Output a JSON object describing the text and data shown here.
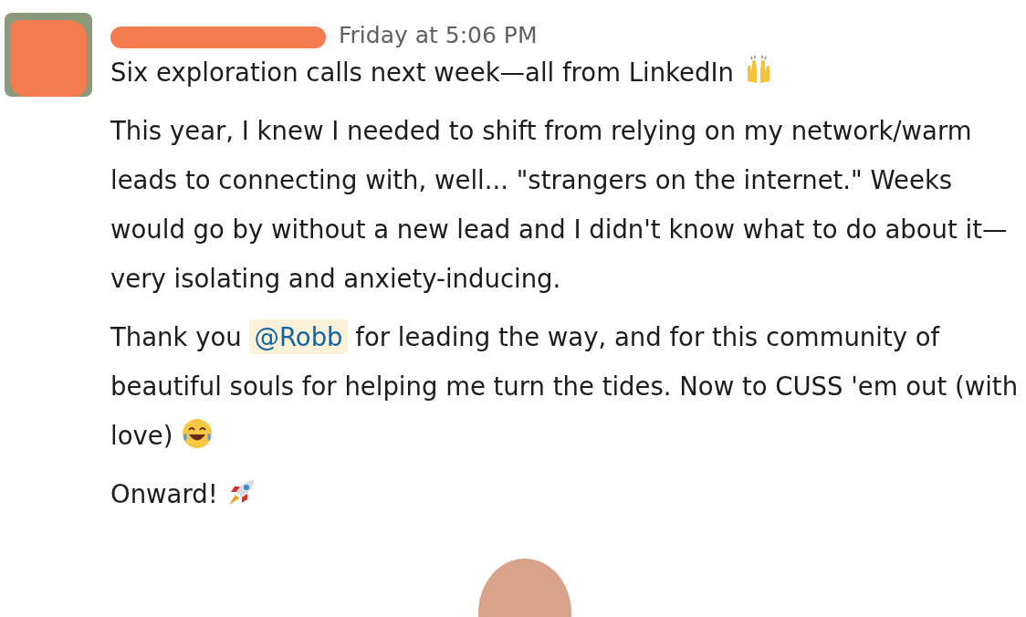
{
  "message": {
    "timestamp": "Friday at 5:06 PM",
    "paragraphs": [
      {
        "segments": [
          {
            "kind": "text",
            "text": "Six exploration calls next week—all from LinkedIn "
          },
          {
            "kind": "hands"
          }
        ]
      },
      {
        "segments": [
          {
            "kind": "text",
            "text": "This year, I knew I needed to shift from relying on my network/warm leads to connecting with, well... \"strangers on the internet.\" Weeks would go by without a new lead and I didn't know what to do about it—very isolating and anxiety-inducing."
          }
        ]
      },
      {
        "segments": [
          {
            "kind": "text",
            "text": "Thank you "
          },
          {
            "kind": "mention",
            "text": "@Robb"
          },
          {
            "kind": "text",
            "text": " for leading the way, and for this community of beautiful souls for helping me turn the tides. Now to CUSS 'em out (with love) "
          },
          {
            "kind": "laugh"
          }
        ]
      },
      {
        "segments": [
          {
            "kind": "text",
            "text": "Onward! "
          },
          {
            "kind": "rocket"
          }
        ]
      }
    ]
  }
}
